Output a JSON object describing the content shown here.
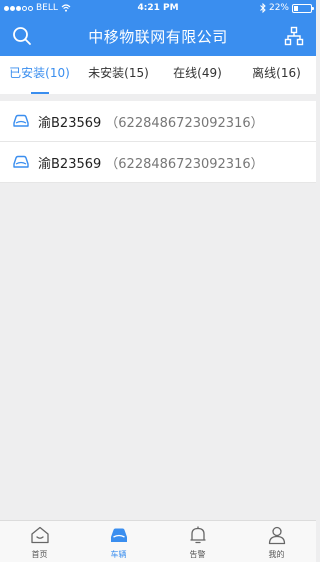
{
  "status_bar": {
    "carrier": "BELL",
    "time": "4:21 PM",
    "battery": "22%",
    "battery_level": 0.22
  },
  "header": {
    "title": "中移物联网有限公司",
    "left_icon": "search-icon",
    "right_icon": "org-chart-icon"
  },
  "tabs": [
    {
      "label": "已安装(10)",
      "active": true
    },
    {
      "label": "未安装(15)",
      "active": false
    },
    {
      "label": "在线(49)",
      "active": false
    },
    {
      "label": "离线(16)",
      "active": false
    }
  ],
  "vehicles": [
    {
      "plate": "渝B23569",
      "sim": "（6228486723092316）",
      "icon": "car-icon"
    },
    {
      "plate": "渝B23569",
      "sim": "（6228486723092316）",
      "icon": "car-icon"
    }
  ],
  "tab_bar": [
    {
      "label": "首页",
      "icon": "home-icon",
      "active": false
    },
    {
      "label": "车辆",
      "icon": "car-icon",
      "active": true
    },
    {
      "label": "告警",
      "icon": "bell-icon",
      "active": false
    },
    {
      "label": "我的",
      "icon": "user-icon",
      "active": false
    }
  ],
  "colors": {
    "accent": "#3a8eef",
    "background": "#eeeeef"
  }
}
